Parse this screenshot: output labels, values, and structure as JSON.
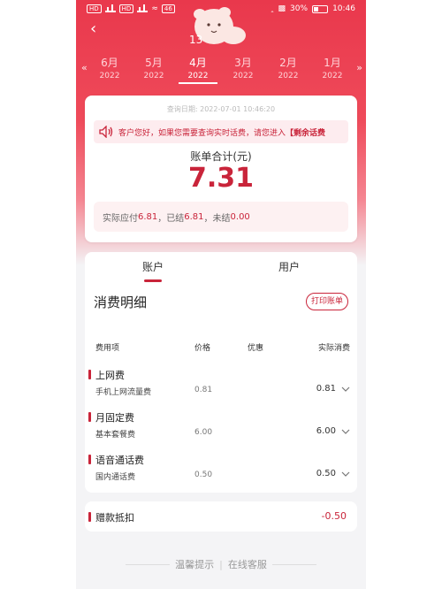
{
  "status_bar": {
    "carrier_tags": [
      "HD",
      "4G",
      "HD",
      "46"
    ],
    "battery": "30%",
    "time": "10:46"
  },
  "nav": {
    "number_fragment": "13"
  },
  "months": [
    {
      "month": "6月",
      "year": "2022"
    },
    {
      "month": "5月",
      "year": "2022"
    },
    {
      "month": "4月",
      "year": "2022"
    },
    {
      "month": "3月",
      "year": "2022"
    },
    {
      "month": "2月",
      "year": "2022"
    },
    {
      "month": "1月",
      "year": "2022"
    }
  ],
  "summary": {
    "query_date": "查询日期: 2022-07-01 10:46:20",
    "notice_text": "客户您好，如果您需要查询实时话费，请您进入",
    "notice_link": "【剩余话费",
    "total_label": "账单合计(元)",
    "total_value": "7.31",
    "pay_prefix": "实际应付",
    "pay_due": "6.81",
    "pay_mid": "，已结",
    "paid": "6.81",
    "pay_mid2": "，未结",
    "unpaid": "0.00"
  },
  "tabs": {
    "account": "账户",
    "user": "用户"
  },
  "details": {
    "title": "消费明细",
    "print_button": "打印账单",
    "columns": {
      "item": "费用项",
      "price": "价格",
      "discount": "优惠",
      "actual": "实际消费"
    },
    "groups": [
      {
        "label": "上网费",
        "item": "手机上网流量费",
        "price": "0.81",
        "actual": "0.81"
      },
      {
        "label": "月固定费",
        "item": "基本套餐费",
        "price": "6.00",
        "actual": "6.00"
      },
      {
        "label": "语音通话费",
        "item": "国内通话费",
        "price": "0.50",
        "actual": "0.50"
      }
    ]
  },
  "discount": {
    "label": "赠款抵扣",
    "amount": "-0.50"
  },
  "footer": {
    "tip": "温馨提示",
    "service": "在线客服"
  },
  "colors": {
    "brand": "#e9384c",
    "accent": "#c9243a"
  }
}
